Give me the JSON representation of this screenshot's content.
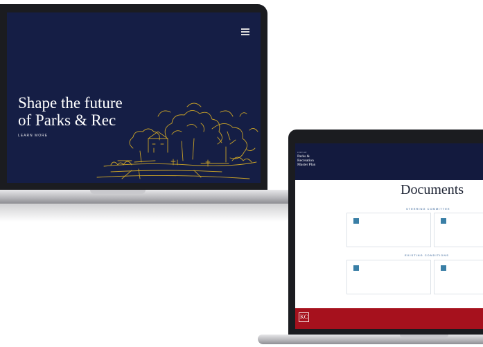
{
  "left_laptop": {
    "hero": {
      "title_line1": "Shape the future",
      "title_line2": "of Parks & Rec",
      "cta_label": "LEARN MORE"
    },
    "icons": {
      "menu": "hamburger-menu-icon"
    }
  },
  "right_laptop": {
    "brand": {
      "top_line": "CITY OF",
      "line1": "Parks &",
      "line2": "Recreation",
      "line3": "Master Plan"
    },
    "page_title": "Documents",
    "sections": [
      {
        "label": "STEERING COMMITTEE"
      },
      {
        "label": "EXISTING CONDITIONS"
      }
    ],
    "footer_logo": "KC"
  },
  "colors": {
    "hero_background": "#151e45",
    "header_background": "#131a3e",
    "footer_red": "#a6111d",
    "sketch_gold": "#c9a227",
    "card_icon_blue": "#3a7fa6"
  }
}
